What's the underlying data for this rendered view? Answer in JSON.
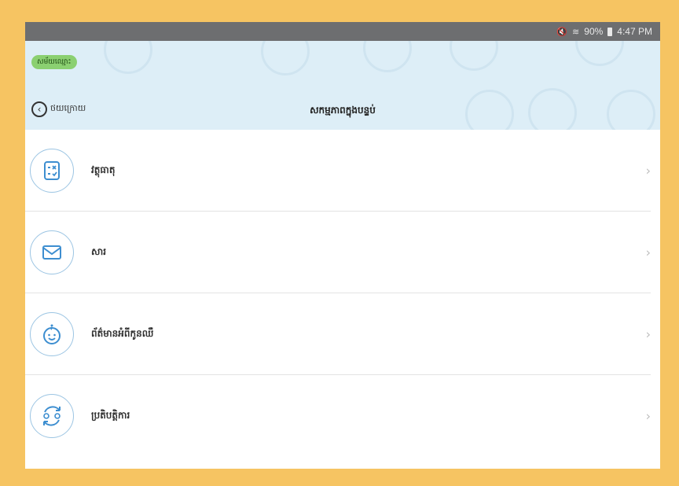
{
  "status_bar": {
    "battery": "90%",
    "time": "4:47 PM"
  },
  "header": {
    "chip_label": "សម័យឈ្មោះ",
    "back_label": "ថយក្រោយ",
    "title": "សកម្មភាពក្នុងបន្ទប់"
  },
  "menu": {
    "items": [
      {
        "label": "វត្ថុធាតុ",
        "icon": "checklist-icon"
      },
      {
        "label": "សារ",
        "icon": "envelope-icon"
      },
      {
        "label": "ព័ត៌មានអំពីកូនឈឺ",
        "icon": "baby-face-icon"
      },
      {
        "label": "ប្រតិបត្តិការ",
        "icon": "sync-people-icon"
      }
    ]
  },
  "colors": {
    "accent": "#3d8ed0",
    "header_bg": "#DDEEF7",
    "chip_bg": "#8bd071",
    "border": "#F6C462"
  }
}
